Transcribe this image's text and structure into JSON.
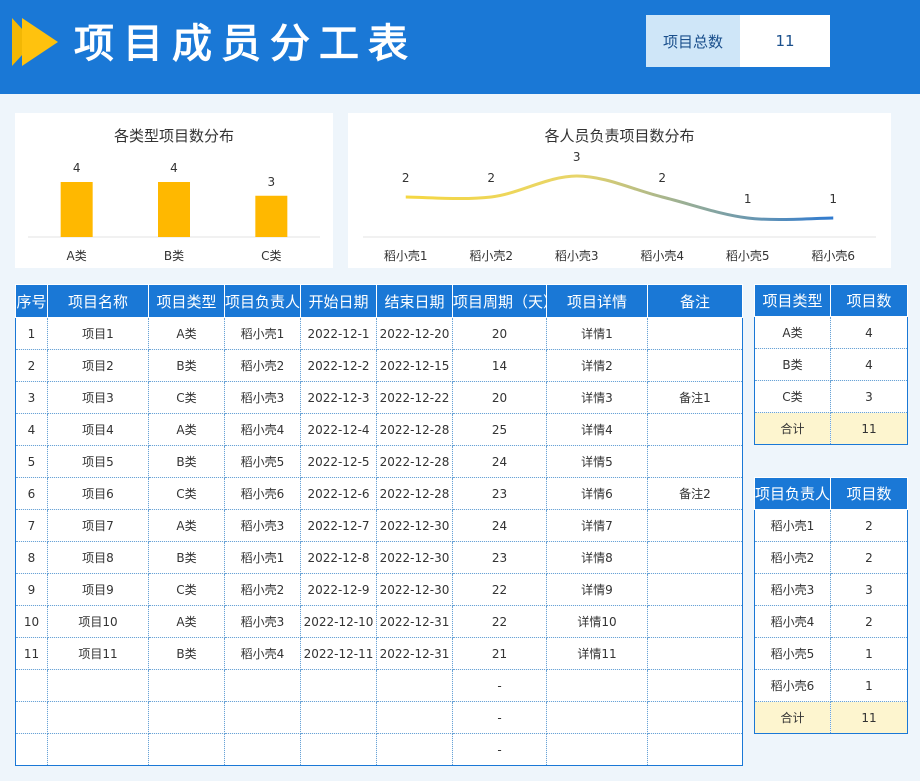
{
  "header": {
    "title": "项目成员分工表",
    "total_label": "项目总数",
    "total_value": "11"
  },
  "colors": {
    "header": "#1a78d6",
    "bar": "#ffb800",
    "line_start": "#f5d742",
    "line_end": "#2f7ad0"
  },
  "chart_data": [
    {
      "type": "bar",
      "title": "各类型项目数分布",
      "categories": [
        "A类",
        "B类",
        "C类"
      ],
      "values": [
        4,
        4,
        3
      ],
      "data_labels": [
        "4",
        "4",
        "3"
      ],
      "ylim": [
        0,
        4
      ],
      "grid": false
    },
    {
      "type": "line",
      "title": "各人员负责项目数分布",
      "categories": [
        "稻小壳1",
        "稻小壳2",
        "稻小壳3",
        "稻小壳4",
        "稻小壳5",
        "稻小壳6"
      ],
      "values": [
        2,
        2,
        3,
        2,
        1,
        1
      ],
      "data_labels": [
        "2",
        "2",
        "3",
        "2",
        "1",
        "1"
      ],
      "smooth": true,
      "grid": false
    }
  ],
  "main_table": {
    "headers": [
      "序号",
      "项目名称",
      "项目类型",
      "项目负责人",
      "开始日期",
      "结束日期",
      "项目周期（天）",
      "项目详情",
      "备注"
    ],
    "rows": [
      [
        "1",
        "项目1",
        "A类",
        "稻小壳1",
        "2022-12-1",
        "2022-12-20",
        "20",
        "详情1",
        ""
      ],
      [
        "2",
        "项目2",
        "B类",
        "稻小壳2",
        "2022-12-2",
        "2022-12-15",
        "14",
        "详情2",
        ""
      ],
      [
        "3",
        "项目3",
        "C类",
        "稻小壳3",
        "2022-12-3",
        "2022-12-22",
        "20",
        "详情3",
        "备注1"
      ],
      [
        "4",
        "项目4",
        "A类",
        "稻小壳4",
        "2022-12-4",
        "2022-12-28",
        "25",
        "详情4",
        ""
      ],
      [
        "5",
        "项目5",
        "B类",
        "稻小壳5",
        "2022-12-5",
        "2022-12-28",
        "24",
        "详情5",
        ""
      ],
      [
        "6",
        "项目6",
        "C类",
        "稻小壳6",
        "2022-12-6",
        "2022-12-28",
        "23",
        "详情6",
        "备注2"
      ],
      [
        "7",
        "项目7",
        "A类",
        "稻小壳3",
        "2022-12-7",
        "2022-12-30",
        "24",
        "详情7",
        ""
      ],
      [
        "8",
        "项目8",
        "B类",
        "稻小壳1",
        "2022-12-8",
        "2022-12-30",
        "23",
        "详情8",
        ""
      ],
      [
        "9",
        "项目9",
        "C类",
        "稻小壳2",
        "2022-12-9",
        "2022-12-30",
        "22",
        "详情9",
        ""
      ],
      [
        "10",
        "项目10",
        "A类",
        "稻小壳3",
        "2022-12-10",
        "2022-12-31",
        "22",
        "详情10",
        ""
      ],
      [
        "11",
        "项目11",
        "B类",
        "稻小壳4",
        "2022-12-11",
        "2022-12-31",
        "21",
        "详情11",
        ""
      ],
      [
        "",
        "",
        "",
        "",
        "",
        "",
        "-",
        "",
        ""
      ],
      [
        "",
        "",
        "",
        "",
        "",
        "",
        "-",
        "",
        ""
      ],
      [
        "",
        "",
        "",
        "",
        "",
        "",
        "-",
        "",
        ""
      ]
    ]
  },
  "type_table": {
    "headers": [
      "项目类型",
      "项目数"
    ],
    "rows": [
      [
        "A类",
        "4"
      ],
      [
        "B类",
        "4"
      ],
      [
        "C类",
        "3"
      ]
    ],
    "total": [
      "合计",
      "11"
    ]
  },
  "person_table": {
    "headers": [
      "项目负责人",
      "项目数"
    ],
    "rows": [
      [
        "稻小壳1",
        "2"
      ],
      [
        "稻小壳2",
        "2"
      ],
      [
        "稻小壳3",
        "3"
      ],
      [
        "稻小壳4",
        "2"
      ],
      [
        "稻小壳5",
        "1"
      ],
      [
        "稻小壳6",
        "1"
      ]
    ],
    "total": [
      "合计",
      "11"
    ]
  }
}
